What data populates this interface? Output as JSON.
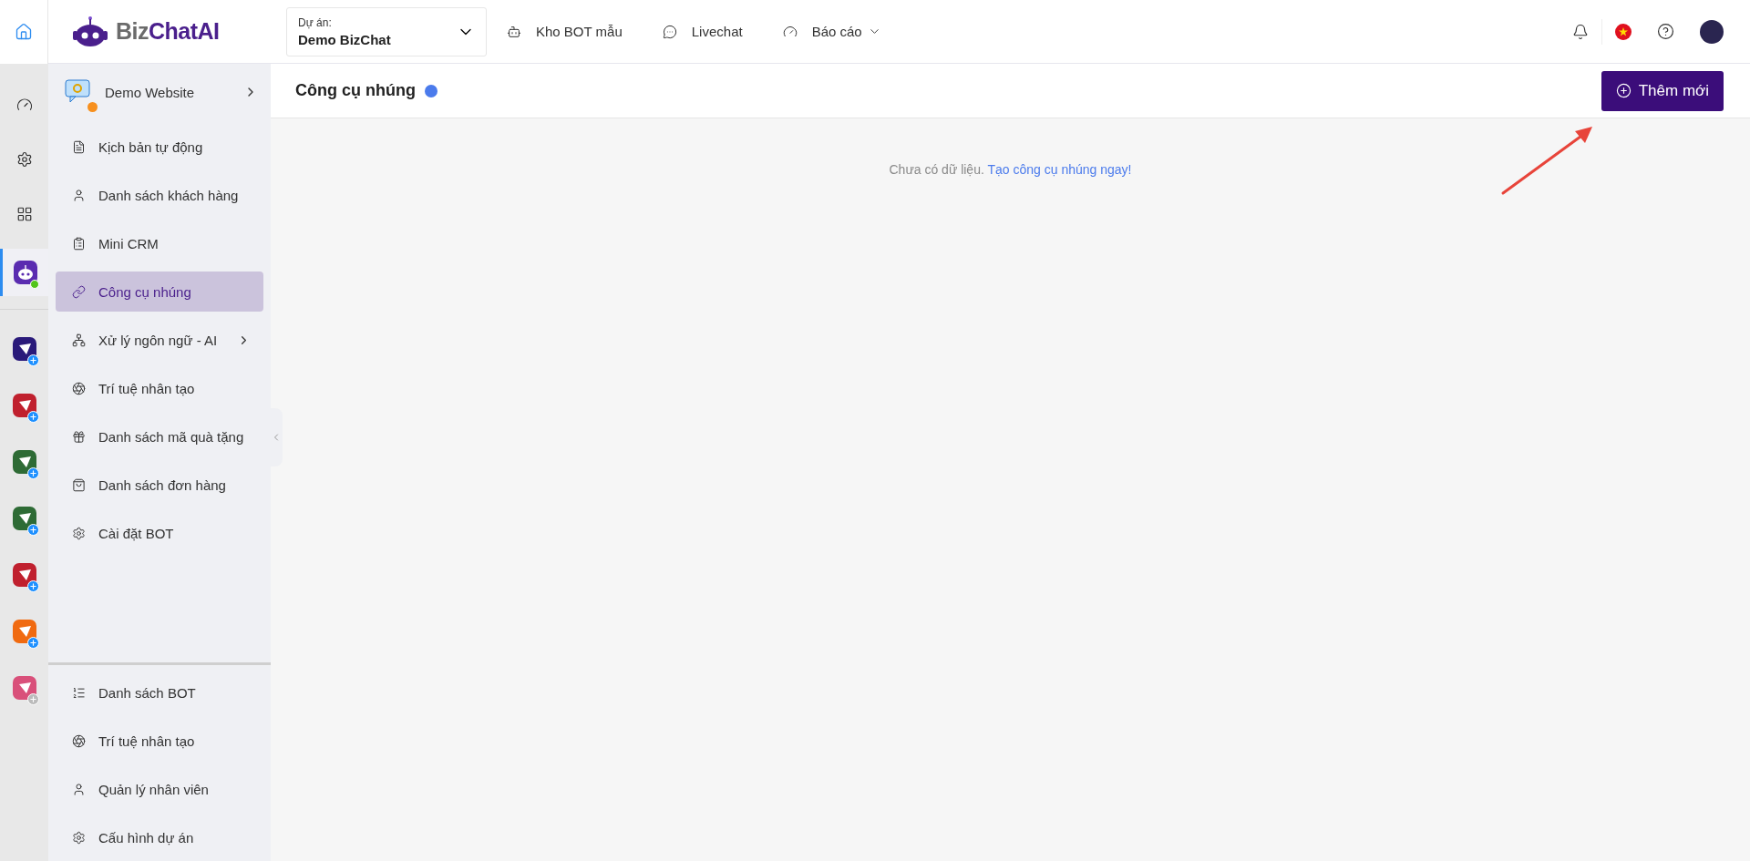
{
  "logo": {
    "prefix": "Biz",
    "name": "ChatAI"
  },
  "project": {
    "label": "Dự án:",
    "value": "Demo BizChat"
  },
  "nav": [
    {
      "label": "Kho BOT mẫu",
      "dropdown": false
    },
    {
      "label": "Livechat",
      "dropdown": false
    },
    {
      "label": "Báo cáo",
      "dropdown": true
    }
  ],
  "active_bot": {
    "selected": true,
    "online": true
  },
  "rail_apps": [
    {
      "color": "#2a1a7a",
      "enabled": true
    },
    {
      "color": "#c0202e",
      "enabled": true
    },
    {
      "color": "#2e6b35",
      "enabled": true
    },
    {
      "color": "#2e6b35",
      "enabled": true
    },
    {
      "color": "#c0202e",
      "enabled": true
    },
    {
      "color": "#f06a10",
      "enabled": true
    },
    {
      "color": "#d9507a",
      "enabled": false
    }
  ],
  "bot": {
    "name": "Demo Website"
  },
  "menu": [
    {
      "label": "Kịch bản tự động",
      "selected": false,
      "submenu": false
    },
    {
      "label": "Danh sách khách hàng",
      "selected": false,
      "submenu": false
    },
    {
      "label": "Mini CRM",
      "selected": false,
      "submenu": false
    },
    {
      "label": "Công cụ nhúng",
      "selected": true,
      "submenu": false
    },
    {
      "label": "Xử lý ngôn ngữ - AI",
      "selected": false,
      "submenu": true
    },
    {
      "label": "Trí tuệ nhân tạo",
      "selected": false,
      "submenu": false
    },
    {
      "label": "Danh sách mã quà tặng",
      "selected": false,
      "submenu": false
    },
    {
      "label": "Danh sách đơn hàng",
      "selected": false,
      "submenu": false
    },
    {
      "label": "Cài đặt BOT",
      "selected": false,
      "submenu": false
    }
  ],
  "bottom_menu": [
    {
      "label": "Danh sách BOT"
    },
    {
      "label": "Trí tuệ nhân tạo"
    },
    {
      "label": "Quản lý nhân viên"
    },
    {
      "label": "Cấu hình dự án"
    }
  ],
  "page": {
    "title": "Công cụ nhúng",
    "add_button": "Thêm mới",
    "empty_text": "Chưa có dữ liệu.",
    "empty_link": "Tạo công cụ nhúng ngay!"
  }
}
